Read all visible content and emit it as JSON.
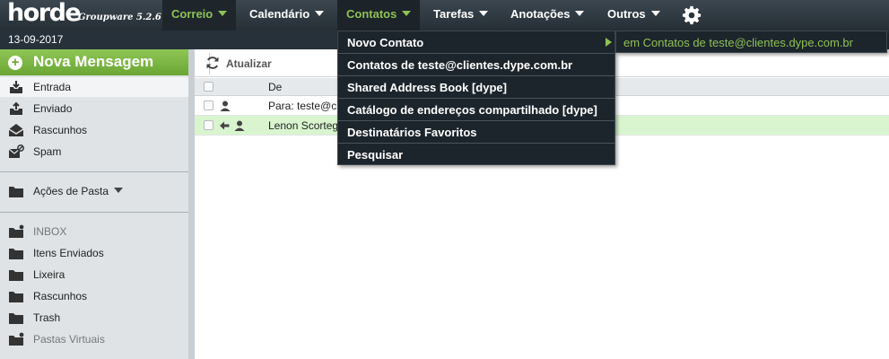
{
  "app": {
    "logo": "horde",
    "logo_sub": "Groupware 5.2.6"
  },
  "menu": {
    "items": [
      {
        "label": "Correio",
        "icon": "chevron-down-icon",
        "state": "active"
      },
      {
        "label": "Calendário",
        "icon": "chevron-down-icon"
      },
      {
        "label": "Contatos",
        "icon": "chevron-down-icon",
        "state": "open"
      },
      {
        "label": "Tarefas",
        "icon": "chevron-down-icon"
      },
      {
        "label": "Anotações",
        "icon": "chevron-down-icon"
      },
      {
        "label": "Outros",
        "icon": "chevron-down-icon"
      }
    ],
    "settings_icon": "gear-icon"
  },
  "date": "13-09-2017",
  "sidebar": {
    "compose_label": "Nova Mensagem",
    "mailboxes": [
      {
        "label": "Entrada",
        "icon": "inbox-icon"
      },
      {
        "label": "Enviado",
        "icon": "sent-icon"
      },
      {
        "label": "Rascunhos",
        "icon": "drafts-icon"
      },
      {
        "label": "Spam",
        "icon": "spam-icon"
      }
    ],
    "folder_actions_label": "Ações de Pasta",
    "folders": [
      {
        "label": "INBOX",
        "icon": "folder-icon"
      },
      {
        "label": "Itens Enviados",
        "icon": "folder-icon"
      },
      {
        "label": "Lixeira",
        "icon": "folder-icon"
      },
      {
        "label": "Rascunhos",
        "icon": "folder-icon"
      },
      {
        "label": "Trash",
        "icon": "folder-icon"
      },
      {
        "label": "Pastas Virtuais",
        "icon": "folder-icon"
      }
    ]
  },
  "toolbar": {
    "refresh_label": "Atualizar",
    "refresh_icon": "refresh-icon"
  },
  "message_list": {
    "columns": [
      "De"
    ],
    "rows": [
      {
        "from": "Para: teste@c",
        "icons": [
          "person-icon"
        ]
      },
      {
        "from": "Lenon Scorteg",
        "icons": [
          "reply-arrow-icon",
          "person-icon"
        ]
      }
    ]
  },
  "contacts_menu": {
    "items": [
      {
        "label": "Novo Contato",
        "has_submenu": true
      },
      {
        "label": "Contatos de teste@clientes.dype.com.br"
      },
      {
        "label": "Shared Address Book [dype]"
      },
      {
        "label": "Catálogo de endereços compartilhado [dype]"
      },
      {
        "label": "Destinatários Favoritos"
      },
      {
        "label": "Pesquisar"
      }
    ],
    "submenu_label": "em Contatos de teste@clientes.dype.com.br"
  },
  "colors": {
    "topbar": "#2e3840",
    "accent_green": "#8fc156",
    "compose_green": "#7ab845",
    "highlight_row": "#d9f5cf",
    "sidebar_bg": "#dfe3e5"
  }
}
